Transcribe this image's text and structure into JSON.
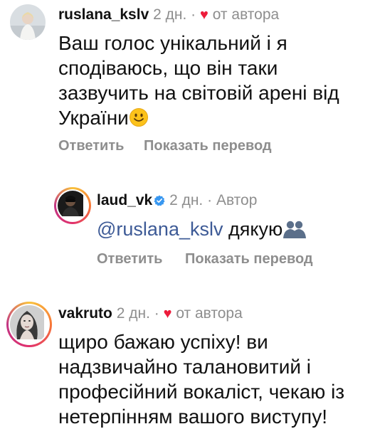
{
  "comments": [
    {
      "username": "ruslana_kslv",
      "time": "2 дн.",
      "sep": "·",
      "badge": "от автора",
      "text": "Ваш голос унікальний і я сподіваюсь, що він таки зазвучить на світовій арені від України",
      "emoji": "smiling-face",
      "reply": "Ответить",
      "translate": "Показать перевод"
    },
    {
      "username": "laud_vk",
      "time": "2 дн.",
      "sep": "·",
      "badge": "Автор",
      "mention": "@ruslana_kslv",
      "text": "дякую",
      "emoji": "people-silhouette",
      "reply": "Ответить",
      "translate": "Показать перевод"
    },
    {
      "username": "vakruto",
      "time": "2 дн.",
      "sep": "·",
      "badge": "от автора",
      "text": "щиро бажаю успіху! ви надзвичайно талановитий і професійний вокаліст, чекаю із нетерпінням вашого виступу!"
    }
  ],
  "colors": {
    "heart": "#ed1c3b",
    "muted": "#8e8e8e",
    "mention": "#3d5a96",
    "verified": "#3897f0"
  },
  "icons": {
    "heart": "heart-icon",
    "verified": "verified-badge-icon"
  }
}
